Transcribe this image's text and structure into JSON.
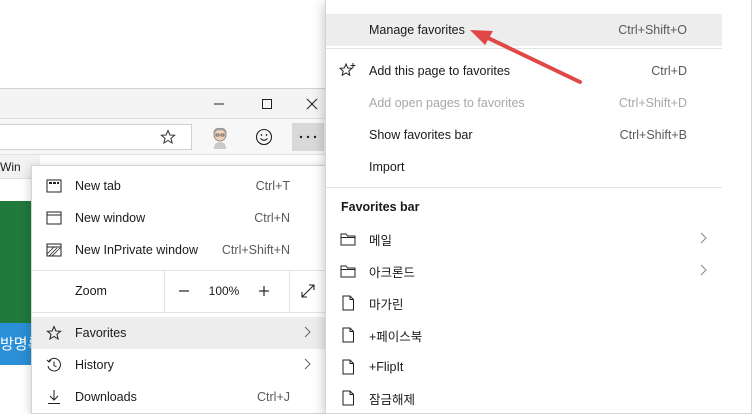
{
  "browser": {
    "favbar_text": "Win",
    "page_text": "방명록"
  },
  "main_menu": {
    "items": [
      {
        "label": "New tab",
        "shortcut": "Ctrl+T",
        "icon": "new-tab-icon"
      },
      {
        "label": "New window",
        "shortcut": "Ctrl+N",
        "icon": "window-icon"
      },
      {
        "label": "New InPrivate window",
        "shortcut": "Ctrl+Shift+N",
        "icon": "inprivate-icon"
      }
    ],
    "zoom": {
      "label": "Zoom",
      "value": "100%",
      "minus": "—",
      "plus": "+"
    },
    "lower_items": [
      {
        "label": "Favorites",
        "shortcut": "",
        "icon": "star-icon"
      },
      {
        "label": "History",
        "shortcut": "",
        "icon": "history-icon"
      },
      {
        "label": "Downloads",
        "shortcut": "Ctrl+J",
        "icon": "download-icon"
      }
    ]
  },
  "favorites_menu": {
    "top_items": [
      {
        "label": "Manage favorites",
        "shortcut": "Ctrl+Shift+O",
        "enabled": true
      },
      {
        "label": "Add this page to favorites",
        "shortcut": "Ctrl+D",
        "enabled": true,
        "icon": "star-plus-icon"
      },
      {
        "label": "Add open pages to favorites",
        "shortcut": "Ctrl+Shift+D",
        "enabled": false
      },
      {
        "label": "Show favorites bar",
        "shortcut": "Ctrl+Shift+B",
        "enabled": true
      },
      {
        "label": "Import",
        "shortcut": "",
        "enabled": true
      }
    ],
    "section_title": "Favorites bar",
    "bar_items": [
      {
        "label": "메일",
        "type": "folder"
      },
      {
        "label": "아크론드",
        "type": "folder"
      },
      {
        "label": "마가린",
        "type": "page"
      },
      {
        "label": "+페이스북",
        "type": "page"
      },
      {
        "label": "+FlipIt",
        "type": "page"
      },
      {
        "label": "잠금해제",
        "type": "page"
      }
    ]
  },
  "colors": {
    "annotation_arrow": "#e04848",
    "hover": "#ededed",
    "disabled_text": "#a8a8a8"
  }
}
